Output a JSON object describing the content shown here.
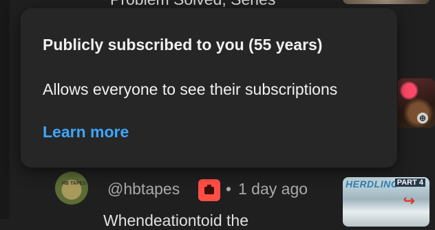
{
  "background": {
    "video_title_partial": "Problem Solved, Series"
  },
  "tooltip": {
    "title": "Publicly subscribed to you (55 years)",
    "description": "Allows everyone to see their subscriptions",
    "link_label": "Learn more"
  },
  "comment": {
    "handle": "@hbtapes",
    "separator": "•",
    "time_ago": "1 day ago",
    "text_partial": "Whendeationtoid the",
    "avatar_text": "HB TAPES"
  },
  "thumbnails": {
    "third_brand": "HERDLING",
    "third_part": "PART 4"
  },
  "colors": {
    "background": "#1f1f1f",
    "tooltip_bg": "#262626",
    "link": "#3ea6ff",
    "badge": "#ff4e45",
    "secondary_text": "#aaaaaa"
  },
  "icons": {
    "badge": "youtube-member-badge-icon"
  }
}
